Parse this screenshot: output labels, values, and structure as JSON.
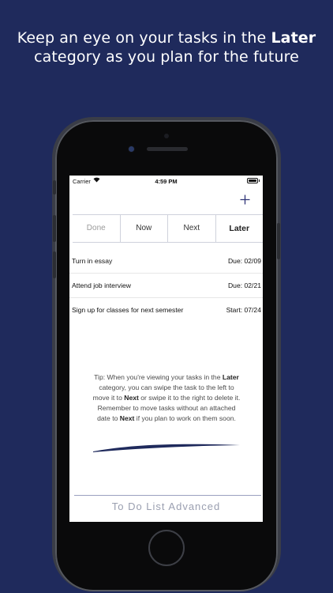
{
  "headline": {
    "part1": "Keep an eye on your tasks in the ",
    "highlight": "Later",
    "part2": "category as you plan for the future"
  },
  "status_bar": {
    "carrier": "Carrier",
    "wifi_icon": "wifi-icon",
    "time": "4:59 PM",
    "battery_icon": "battery-icon"
  },
  "toolbar": {
    "add_icon": "plus-icon"
  },
  "tabs": [
    {
      "label": "Done"
    },
    {
      "label": "Now"
    },
    {
      "label": "Next"
    },
    {
      "label": "Later"
    }
  ],
  "tasks": [
    {
      "name": "Turn in essay",
      "date": "Due: 02/09"
    },
    {
      "name": "Attend job interview",
      "date": "Due: 02/21"
    },
    {
      "name": "Sign up for classes for next semester",
      "date": "Start: 07/24"
    }
  ],
  "tip": {
    "t1": "Tip: When you're viewing your tasks in the ",
    "b1": "Later",
    "t2": " category, you can swipe the task to the left to move it to ",
    "b2": "Next",
    "t3": " or swipe it to the right to delete it. Remember to move tasks without an attached date to ",
    "b3": "Next",
    "t4": " if you plan to work on them soon."
  },
  "footer": {
    "title": "To Do List Advanced"
  },
  "colors": {
    "background": "#1f2a5c",
    "accent": "#2f3478"
  }
}
